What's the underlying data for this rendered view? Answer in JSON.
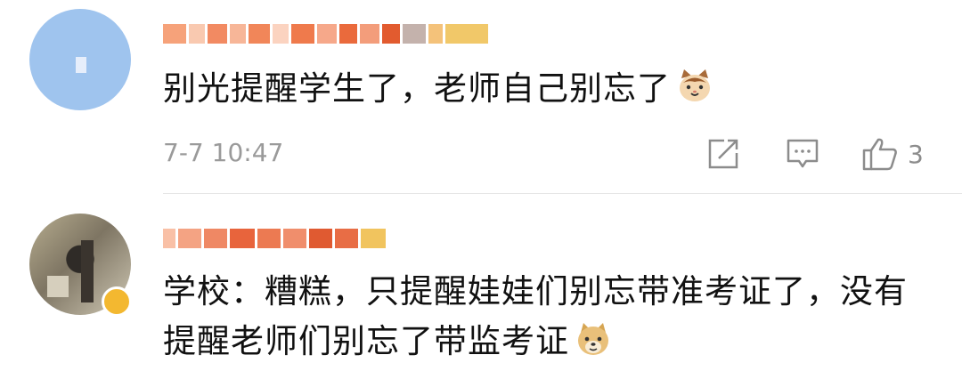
{
  "comments": [
    {
      "text": "别光提醒学生了，老师自己别忘了",
      "timestamp": "7-7 10:47",
      "like_count": "3",
      "emoji": "cat-face-emoji"
    },
    {
      "text": "学校：糟糕，只提醒娃娃们别忘带准考证了，没有提醒老师们别忘了带监考证",
      "emoji": "doge-emoji"
    }
  ],
  "colors": {
    "text": "#111111",
    "meta": "#9a9a9a",
    "divider": "#e6e6e6",
    "vip": "#f3b830"
  }
}
